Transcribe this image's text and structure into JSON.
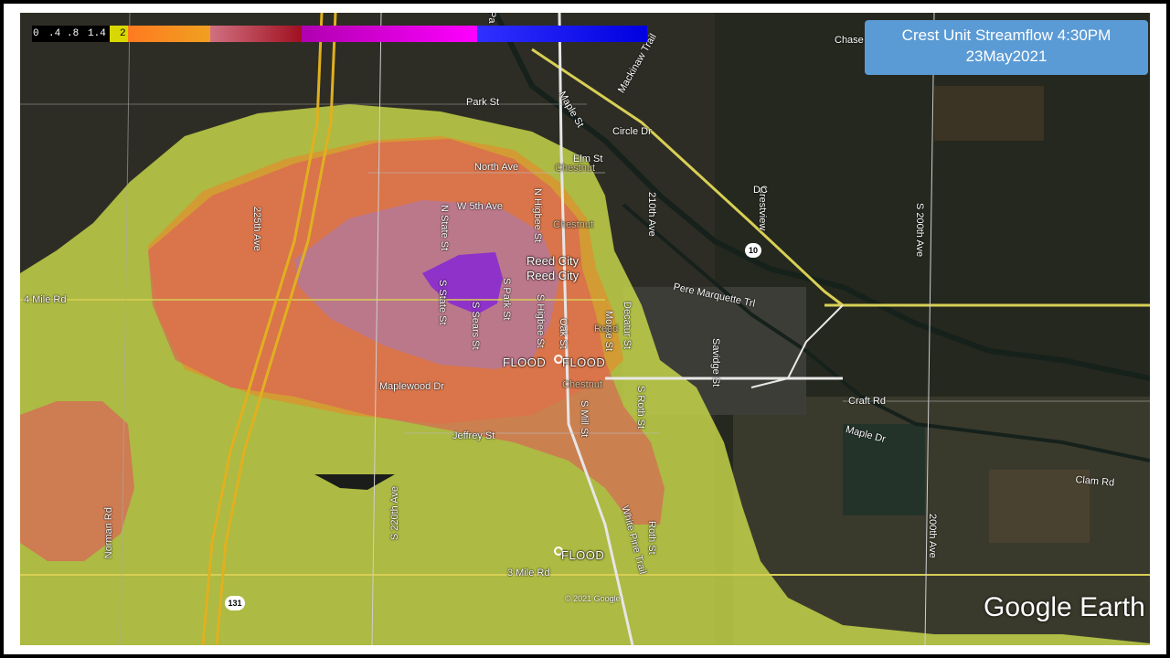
{
  "title": {
    "line1": "Crest Unit Streamflow 4:30PM",
    "line2": "23May2021"
  },
  "legend": {
    "ticks": [
      "0",
      ".4",
      ".8",
      "1.4",
      "2"
    ],
    "colors": [
      "#000000",
      "#000000",
      "#000000",
      "#d8d800",
      "#f0a020",
      "#ff7a20",
      "#d07080",
      "#a01020",
      "#b000b0",
      "#ff00ff",
      "#3030ff",
      "#0000e0"
    ]
  },
  "roads": {
    "park_st": "Park St",
    "north_ave": "North Ave",
    "w5th_ave": "W 5th Ave",
    "elm_st": "Elm St",
    "maple_st": "Maple St",
    "circle_dr": "Circle Dr",
    "mackinaw_trail": "Mackinaw Trail",
    "chase": "Chase",
    "n_state_st": "N State St",
    "n_higbee_st": "N Higbee St",
    "s_state_st": "S State St",
    "s_sears_st": "S Sears St",
    "s_park_st": "S Park St",
    "s_higbee_st": "S Higbee St",
    "morse_st": "Morse St",
    "decatur_st": "Decatur St",
    "chestnut1": "Chestnut",
    "chestnut2": "Chestnut",
    "chestnut3": "Chestnut",
    "ave_225th": "225th Ave",
    "ave_210th": "210th Ave",
    "s_200th_ave": "S 200th Ave",
    "ave_200th": "200th Ave",
    "s_220th_ave": "S 220th Ave",
    "mile4": "4 Mile Rd",
    "mile3": "3 Mile Rd",
    "pere_marquette": "Pere Marquette Trl",
    "savidge_st": "Savidge St",
    "craft_rd": "Craft Rd",
    "maple_dr": "Maple Dr",
    "clam_rd": "Clam Rd",
    "maplewood_dr": "Maplewood Dr",
    "jeffrey_st": "Jeffrey St",
    "s_mill_st": "S Mill St",
    "s_roth_st": "S Roth St",
    "roth_st": "Roth St",
    "white_pine_trail": "White Pine Trail",
    "norman_rd": "Norman Rd",
    "crestview": "Crestview",
    "dc": "DC",
    "oak_st": "Oak St",
    "reed_partial": "Reed",
    "park_partial": "Pa"
  },
  "places": {
    "reed_city_1": "Reed City",
    "reed_city_2": "Reed City",
    "flood_1": "FLOOD",
    "flood_2": "FLOOD",
    "flood_3": "FLOOD"
  },
  "shields": {
    "us10": "10",
    "us131": "131"
  },
  "footer": {
    "copyright": "© 2021 Google",
    "logo": "Google Earth"
  },
  "colors": {
    "flood_yellow": "#c9d94a",
    "flood_orange": "#e0902e",
    "flood_red": "#e05a5a",
    "flood_mauve": "#b07aa0",
    "flood_purple": "#8a2ad0",
    "title_bg": "#5b9bd5"
  }
}
